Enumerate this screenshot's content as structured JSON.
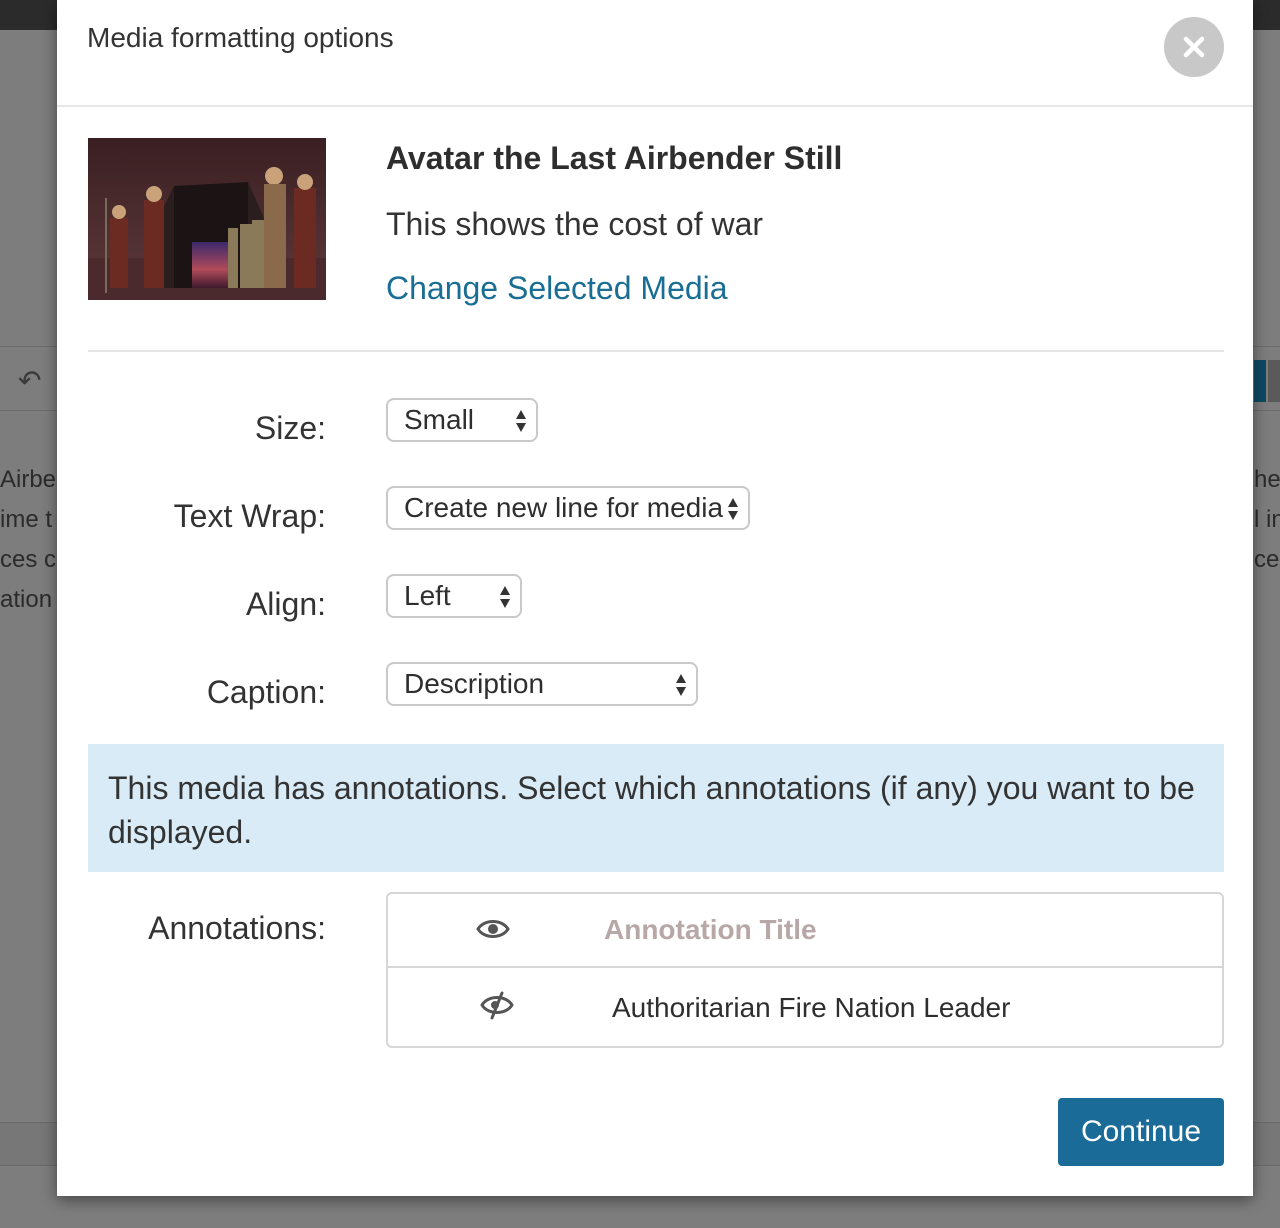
{
  "background": {
    "left_text": [
      "Airber",
      "ime t",
      "ces ca",
      "ation"
    ],
    "right_text": [
      "he",
      "l in",
      "ce",
      ""
    ]
  },
  "modal": {
    "title": "Media formatting options",
    "close_icon": "close-icon"
  },
  "media": {
    "title": "Avatar the Last Airbender Still",
    "description": "This shows the cost of war",
    "change_link": "Change Selected Media"
  },
  "form": {
    "size": {
      "label": "Size:",
      "value": "Small"
    },
    "text_wrap": {
      "label": "Text Wrap:",
      "value": "Create new line for media"
    },
    "align": {
      "label": "Align:",
      "value": "Left"
    },
    "caption": {
      "label": "Caption:",
      "value": "Description"
    }
  },
  "annotations_notice": "This media has annotations. Select which annotations (if any) you want to be displayed.",
  "annotations": {
    "label": "Annotations:",
    "header_icon": "eye-icon",
    "header_title": "Annotation Title",
    "rows": [
      {
        "icon": "eye-slash-icon",
        "title": "Authoritarian Fire Nation Leader"
      }
    ]
  },
  "buttons": {
    "continue": "Continue"
  },
  "colors": {
    "primary": "#1a6b97",
    "link": "#1a6e94",
    "info_bg": "#d9ebf7",
    "header_muted": "#b8a7a7"
  }
}
